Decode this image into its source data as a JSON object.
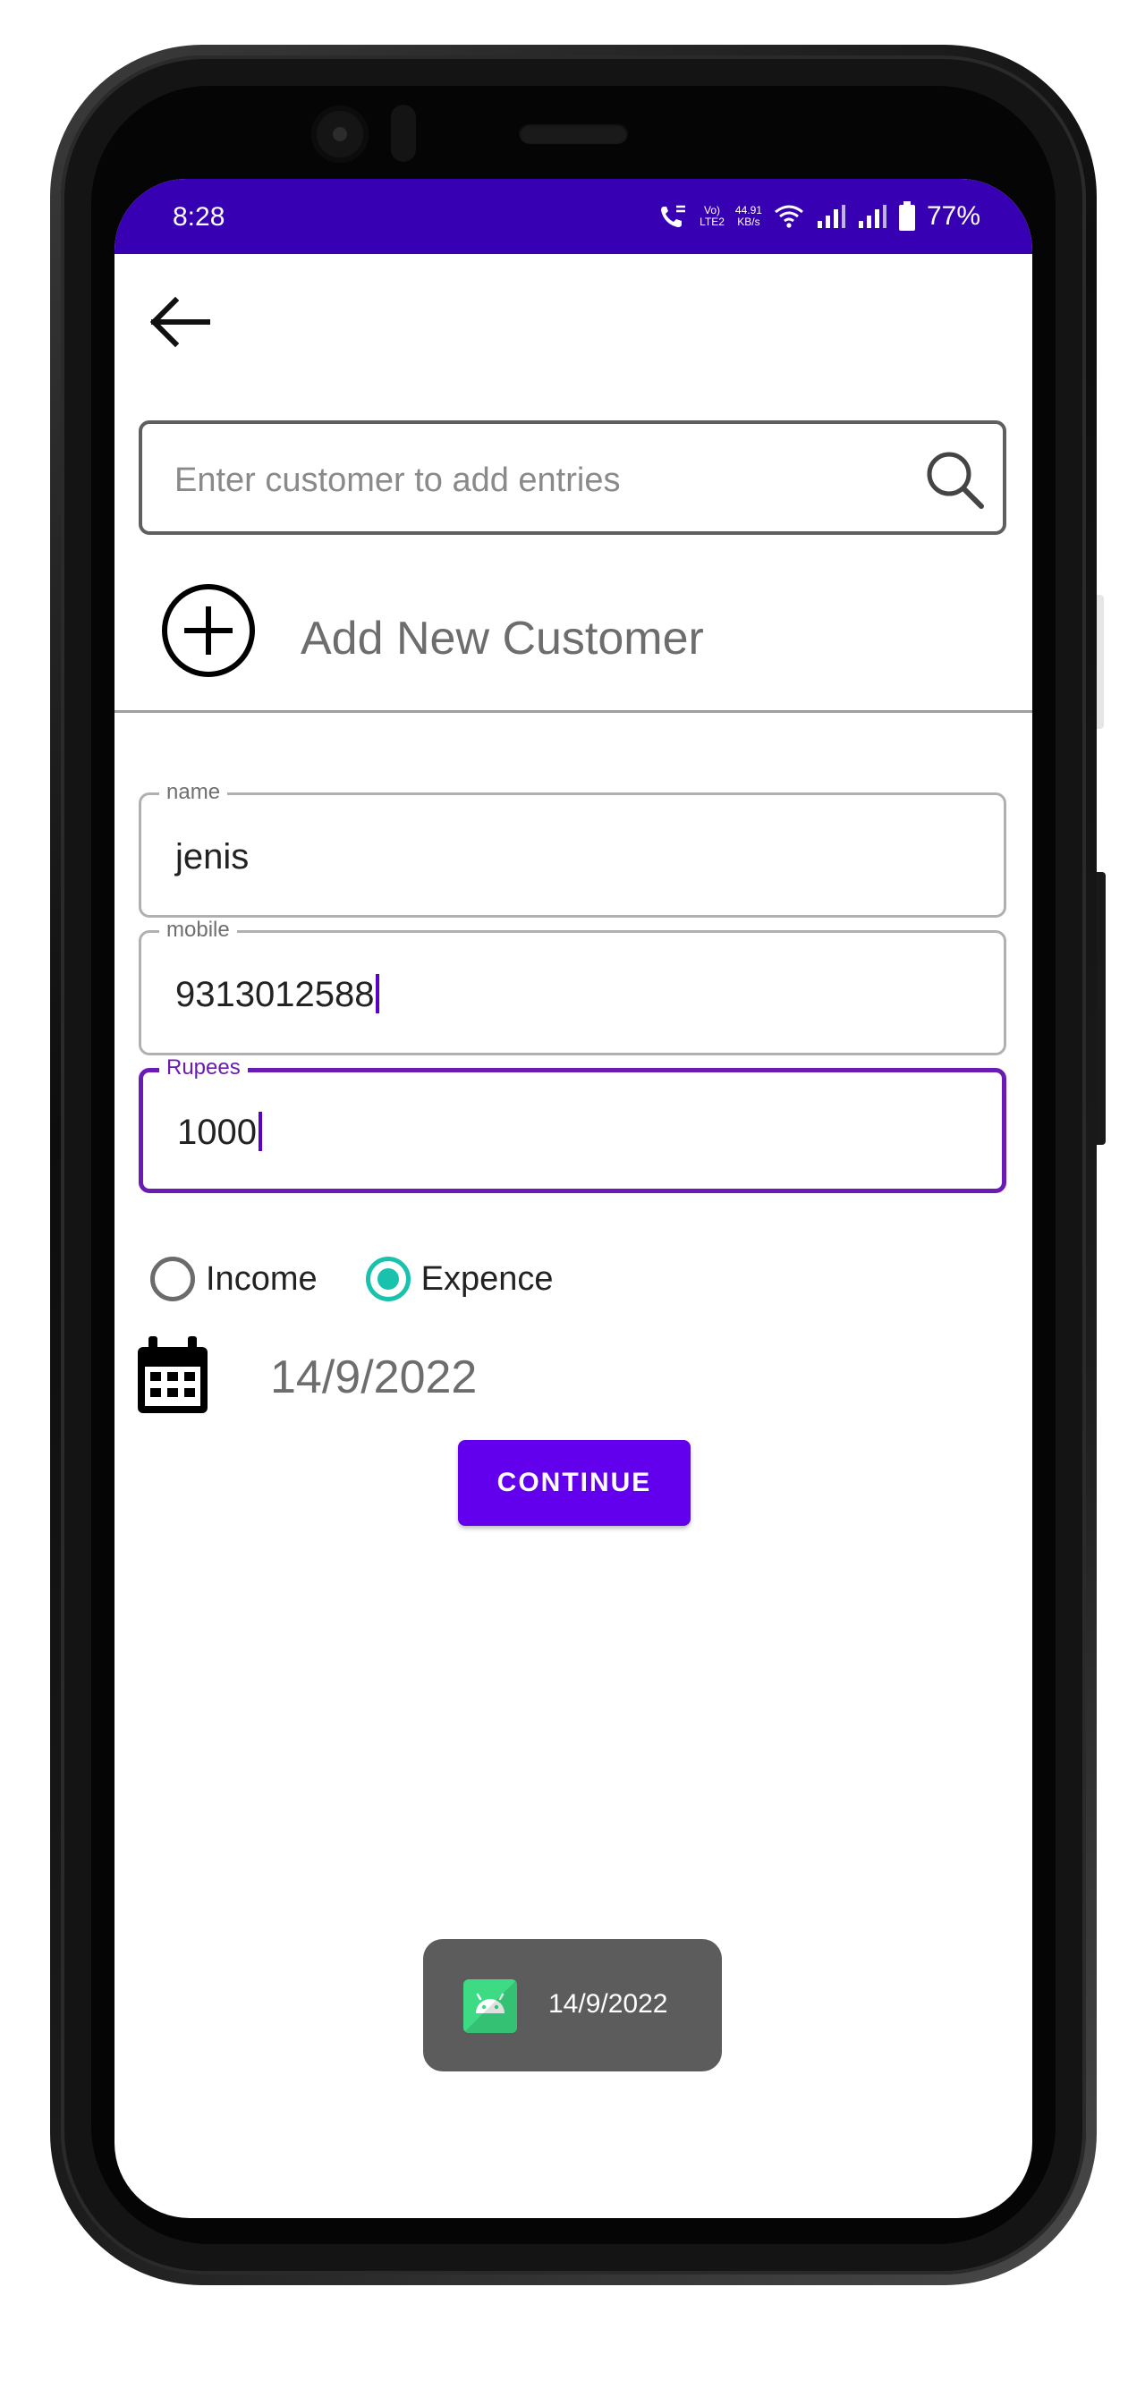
{
  "status_bar": {
    "time": "8:28",
    "volte_top": "Vo)",
    "volte_bottom": "LTE2",
    "speed_top": "44.91",
    "speed_bottom": "KB/s",
    "battery": "77%"
  },
  "search": {
    "placeholder": "Enter customer to add entries"
  },
  "add_customer": {
    "label": "Add New Customer"
  },
  "form": {
    "name_label": "name",
    "name_value": "jenis",
    "mobile_label": "mobile",
    "mobile_value": "9313012588",
    "rupees_label": "Rupees",
    "rupees_value": "1000"
  },
  "radios": {
    "income_label": "Income",
    "expence_label": "Expence",
    "selected": "Expence"
  },
  "date": {
    "value": "14/9/2022"
  },
  "continue_label": "CONTINUE",
  "toast": {
    "message": "14/9/2022"
  },
  "colors": {
    "status_bar": "#3700b3",
    "primary": "#6200ee",
    "focused_outline": "#6a1bb5",
    "radio_checked": "#19c2ad"
  },
  "icons": [
    "back-arrow-icon",
    "search-icon",
    "add-circle-icon",
    "calendar-icon",
    "android-app-icon",
    "wifi-icon",
    "signal-icon",
    "battery-icon",
    "call-icon"
  ]
}
